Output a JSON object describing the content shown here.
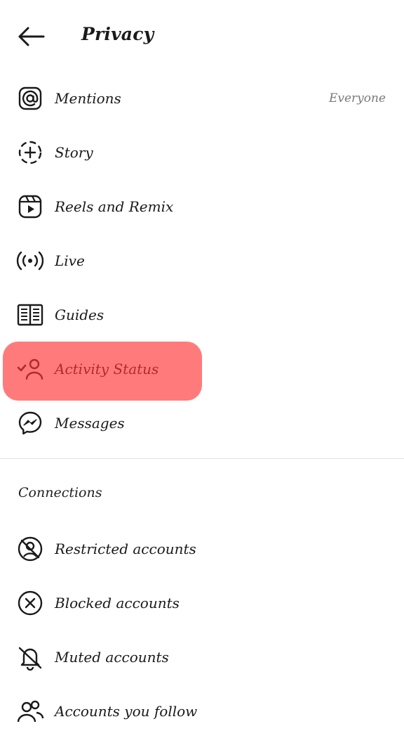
{
  "header": {
    "title": "Privacy",
    "back_icon": "arrow-left-icon"
  },
  "privacy_items": [
    {
      "label": "Mentions",
      "value": "Everyone",
      "icon": "at-sign-icon"
    },
    {
      "label": "Story",
      "icon": "story-add-icon"
    },
    {
      "label": "Reels and Remix",
      "icon": "reels-icon"
    },
    {
      "label": "Live",
      "icon": "live-broadcast-icon"
    },
    {
      "label": "Guides",
      "icon": "guides-book-icon"
    },
    {
      "label": "Activity Status",
      "icon": "activity-status-icon",
      "highlighted": true
    },
    {
      "label": "Messages",
      "icon": "messenger-icon"
    }
  ],
  "connections": {
    "title": "Connections",
    "items": [
      {
        "label": "Restricted accounts",
        "icon": "restricted-icon"
      },
      {
        "label": "Blocked accounts",
        "icon": "blocked-icon"
      },
      {
        "label": "Muted accounts",
        "icon": "muted-bell-icon"
      },
      {
        "label": "Accounts you follow",
        "icon": "accounts-follow-icon"
      }
    ]
  },
  "colors": {
    "highlight": "#ff7b7b",
    "highlight_text": "#b22a2a",
    "muted_text": "#7a7a7a"
  }
}
